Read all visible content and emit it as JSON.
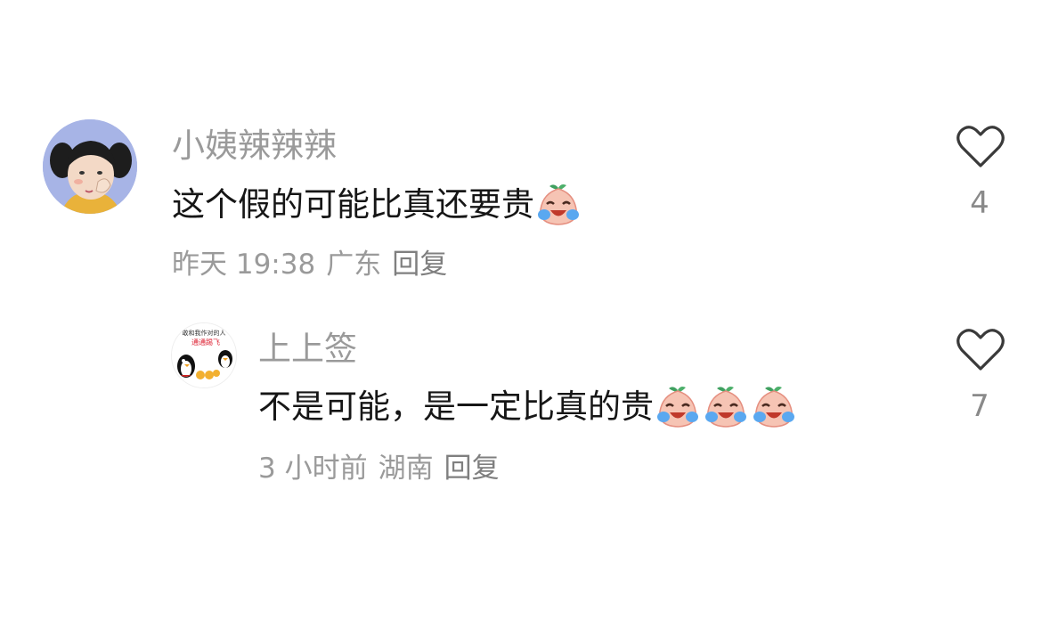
{
  "comments": [
    {
      "username": "小姨辣辣辣",
      "text": "这个假的可能比真还要贵",
      "emoji_icon": "crying-laughing-peach-emoji",
      "emoji_count": 1,
      "time": "昨天 19:38",
      "location": "广东",
      "reply_label": "回复",
      "like_count": "4",
      "avatar_icon": "cartoon-girl-avatar"
    },
    {
      "username": "上上签",
      "text": "不是可能，是一定比真的贵",
      "emoji_icon": "crying-laughing-peach-emoji",
      "emoji_count": 3,
      "time": "3 小时前",
      "location": "湖南",
      "reply_label": "回复",
      "like_count": "7",
      "avatar_icon": "penguin-meme-avatar",
      "avatar_caption": "敢和我作对的人",
      "avatar_caption2": "通通踢飞"
    }
  ],
  "colors": {
    "username": "#9a9a9a",
    "text": "#161616",
    "meta": "#9a9a9a",
    "heart_outline": "#3a3a3a"
  }
}
